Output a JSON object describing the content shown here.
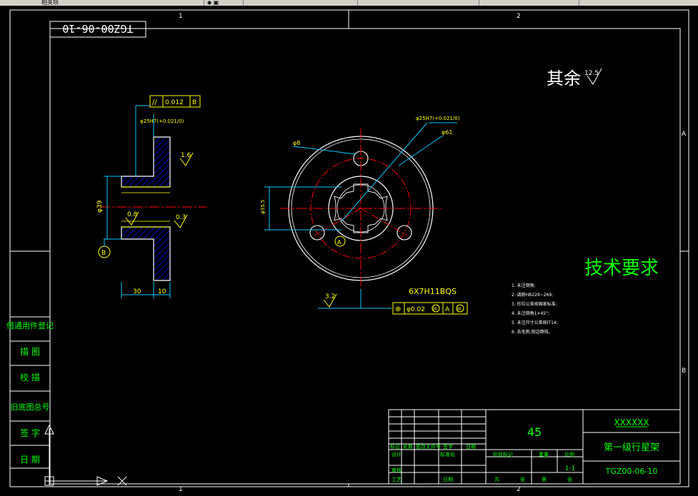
{
  "toolbar": {
    "layer_label": "相关项",
    "dropdown_1": "",
    "dropdown_2": "",
    "dropdown_3": "",
    "dropdown_4": ""
  },
  "drawing": {
    "frame_zone_top_1": "1",
    "frame_zone_top_2": "2",
    "frame_zone_bottom_1": "1",
    "frame_zone_bottom_2": "2",
    "frame_zone_right_a": "A",
    "frame_zone_right_b": "B",
    "drawing_number_mirrored": "TGZ00-06-10",
    "roughness_note_prefix": "其余",
    "roughness_value_default": "12.5",
    "section_view": {
      "parallelism_symbol": "//",
      "parallelism_value": "0.012",
      "parallelism_datum": "B",
      "bore_fit": "φ25H7(+0.021/0)",
      "roughness_face": "1.6",
      "roughness_bore": "0.8",
      "roughness_keyway": "0.3",
      "diameter_dim": "φ39",
      "datum_b": "B",
      "dim_hub_length": "30",
      "dim_flange_thick": "10"
    },
    "front_view": {
      "hole_dim": "φ8",
      "bore_dim": "φ25H7(+0.021/0)",
      "outer_dim": "φ61",
      "spline_dim": "φ35.5",
      "datum_a": "A",
      "spline_spec": "6X7H11BQS",
      "roughness_spline": "3.2",
      "position_symbol": "⊕",
      "position_value": "φ0.02",
      "position_modifier": "M",
      "position_datum": "A",
      "position_datum_modifier": "M"
    },
    "tech_requirements": {
      "title": "技术要求",
      "items": [
        "1. 未注倒角;",
        "2. 调质HB229~269;",
        "3. 形位公差按国家标准;",
        "4. 未注倒角1×45°;",
        "5. 未注尺寸公差按IT14;",
        "6. 去毛刺,锐边倒钝。"
      ]
    },
    "left_strip": [
      "借通用件登记",
      "描 图",
      "校 描",
      "旧底图总号",
      "签 字",
      "日 期"
    ],
    "title_block": {
      "material": "45",
      "company": "XXXXXX",
      "part_name": "第一级行星架",
      "drawing_no": "TGZ00-06-10",
      "scale": "1:1",
      "row_labels_1": [
        "标记",
        "处数",
        "更改文件号",
        "签字",
        "日期"
      ],
      "row_labels_2": [
        "设计",
        "标准化"
      ],
      "row_labels_3": [
        "审核"
      ],
      "row_labels_4": [
        "工艺",
        "日期"
      ],
      "stage_label": "阶段标记",
      "weight_label": "重量",
      "scale_label": "比例",
      "sheet_total": "共",
      "sheet_label": "张",
      "sheet_no": "第",
      "sheet_label_2": "张"
    }
  },
  "colors": {
    "frame": "#ffffff",
    "dimension": "#00c8ff",
    "centerline": "#ff0000",
    "text": "#00ff00",
    "hatch": "#0000ff",
    "symbols": "#ffff00",
    "outline": "#ffffff"
  }
}
